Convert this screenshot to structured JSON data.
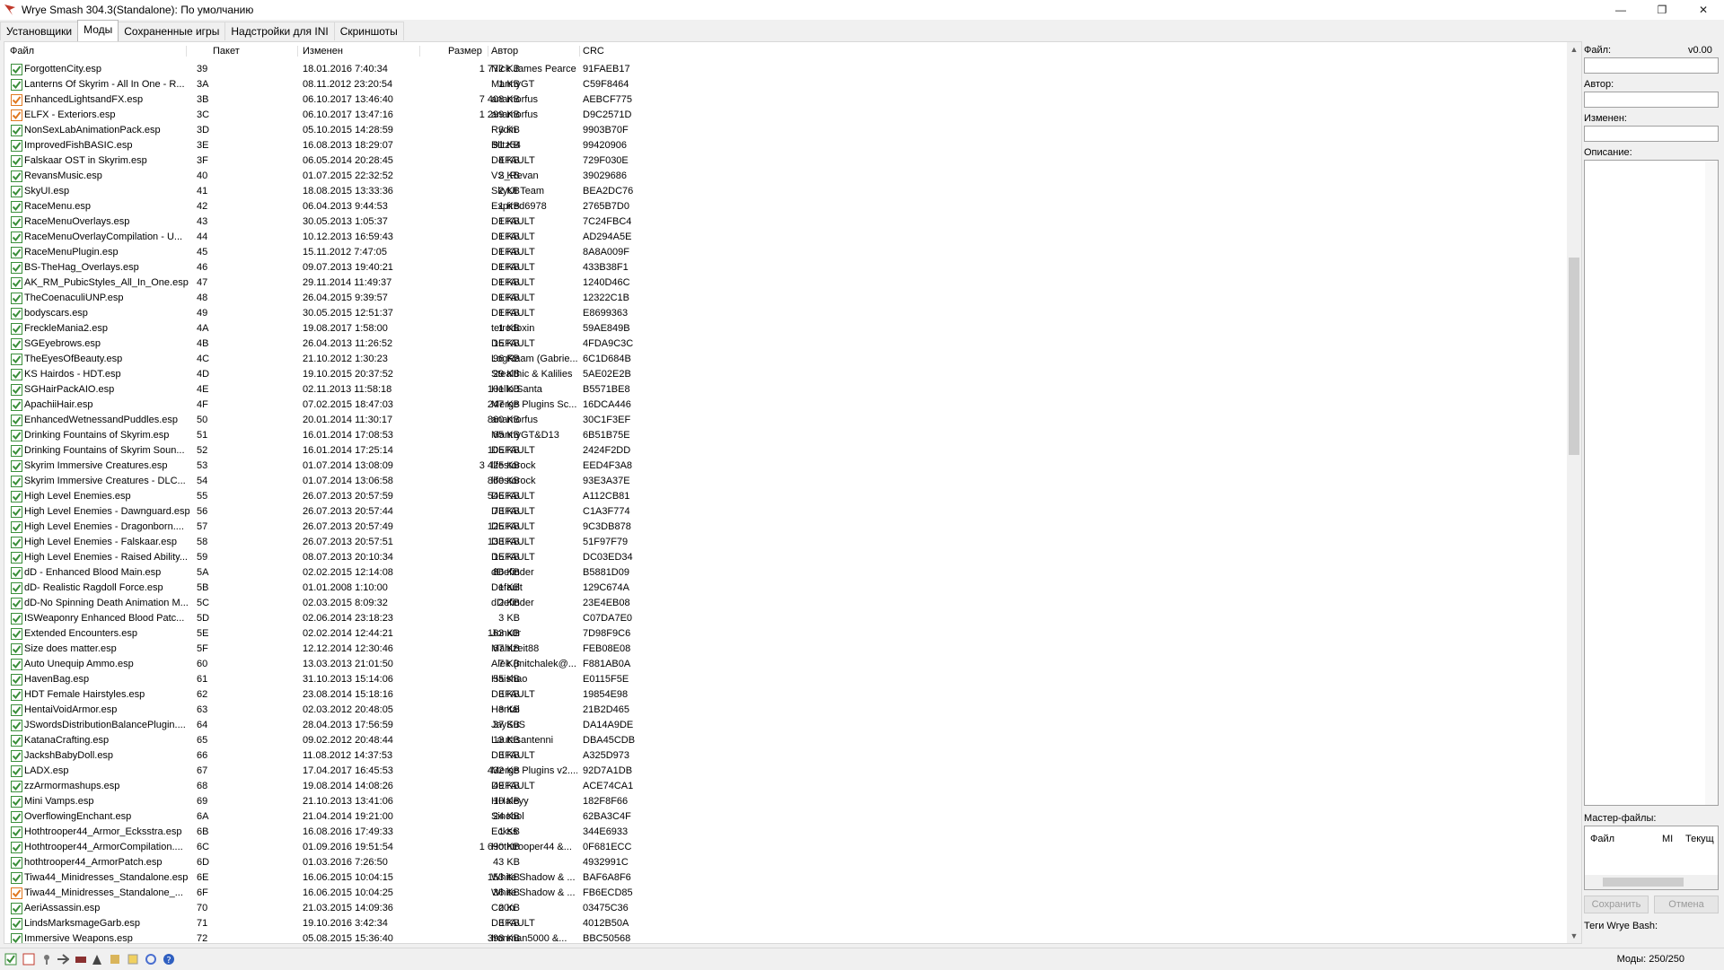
{
  "window": {
    "title": "Wrye Smash 304.3(Standalone): По умолчанию",
    "controls": [
      "—",
      "❐",
      "✕"
    ]
  },
  "tabs": [
    {
      "label": "Установщики",
      "active": false
    },
    {
      "label": "Моды",
      "active": true
    },
    {
      "label": "Сохраненные игры",
      "active": false
    },
    {
      "label": "Надстройки для INI",
      "active": false
    },
    {
      "label": "Скриншоты",
      "active": false
    }
  ],
  "columns": {
    "file": "Файл",
    "package": "Пакет",
    "modified": "Изменен",
    "size": "Размер",
    "author": "Автор",
    "crc": "CRC"
  },
  "rows": [
    {
      "file": "ForgottenCity.esp",
      "pkg": "39",
      "mod": "18.01.2016 7:40:34",
      "size": "1 772 KB",
      "author": "Nick James Pearce",
      "crc": "91FAEB17",
      "check": "green"
    },
    {
      "file": "Lanterns Of Skyrim - All In One - R...",
      "pkg": "3A",
      "mod": "08.11.2012 23:20:54",
      "size": "1 KB",
      "author": "MannyGT",
      "crc": "C59F8464",
      "check": "green"
    },
    {
      "file": "EnhancedLightsandFX.esp",
      "pkg": "3B",
      "mod": "06.10.2017 13:46:40",
      "size": "7 408 KB",
      "author": "anamorfus",
      "crc": "AEBCF775",
      "check": "orange"
    },
    {
      "file": "ELFX - Exteriors.esp",
      "pkg": "3C",
      "mod": "06.10.2017 13:47:16",
      "size": "1 299 KB",
      "author": "anamorfus",
      "crc": "D9C2571D",
      "check": "orange"
    },
    {
      "file": "NonSexLabAnimationPack.esp",
      "pkg": "3D",
      "mod": "05.10.2015 14:28:59",
      "size": "3 KB",
      "author": "Rydin",
      "crc": "9903B70F",
      "check": "green"
    },
    {
      "file": "ImprovedFishBASIC.esp",
      "pkg": "3E",
      "mod": "16.08.2013 18:29:07",
      "size": "91 KB",
      "author": "Blitz54",
      "crc": "99420906",
      "check": "green"
    },
    {
      "file": "Falskaar OST in Skyrim.esp",
      "pkg": "3F",
      "mod": "06.05.2014 20:28:45",
      "size": "4 KB",
      "author": "DEFAULT",
      "crc": "729F030E",
      "check": "green"
    },
    {
      "file": "RevansMusic.esp",
      "pkg": "40",
      "mod": "01.07.2015 22:32:52",
      "size": "2 KB",
      "author": "VS_Revan",
      "crc": "39029686",
      "check": "green"
    },
    {
      "file": "SkyUI.esp",
      "pkg": "41",
      "mod": "18.08.2015 13:33:36",
      "size": "2 KB",
      "author": "SkyUI Team",
      "crc": "BEA2DC76",
      "check": "green"
    },
    {
      "file": "RaceMenu.esp",
      "pkg": "42",
      "mod": "06.04.2013 9:44:53",
      "size": "1 KB",
      "author": "Expired6978",
      "crc": "2765B7D0",
      "check": "green"
    },
    {
      "file": "RaceMenuOverlays.esp",
      "pkg": "43",
      "mod": "30.05.2013 1:05:37",
      "size": "1 KB",
      "author": "DEFAULT",
      "crc": "7C24FBC4",
      "check": "green"
    },
    {
      "file": "RaceMenuOverlayCompilation - U...",
      "pkg": "44",
      "mod": "10.12.2013 16:59:43",
      "size": "1 KB",
      "author": "DEFAULT",
      "crc": "AD294A5E",
      "check": "green"
    },
    {
      "file": "RaceMenuPlugin.esp",
      "pkg": "45",
      "mod": "15.11.2012 7:47:05",
      "size": "1 KB",
      "author": "DEFAULT",
      "crc": "8A8A009F",
      "check": "green"
    },
    {
      "file": "BS-TheHag_Overlays.esp",
      "pkg": "46",
      "mod": "09.07.2013 19:40:21",
      "size": "1 KB",
      "author": "DEFAULT",
      "crc": "433B38F1",
      "check": "green"
    },
    {
      "file": "AK_RM_PubicStyles_All_In_One.esp",
      "pkg": "47",
      "mod": "29.11.2014 11:49:37",
      "size": "1 KB",
      "author": "DEFAULT",
      "crc": "1240D46C",
      "check": "green"
    },
    {
      "file": "TheCoenaculiUNP.esp",
      "pkg": "48",
      "mod": "26.04.2015 9:39:57",
      "size": "1 KB",
      "author": "DEFAULT",
      "crc": "12322C1B",
      "check": "green"
    },
    {
      "file": "bodyscars.esp",
      "pkg": "49",
      "mod": "30.05.2015 12:51:37",
      "size": "1 KB",
      "author": "DEFAULT",
      "crc": "E8699363",
      "check": "green"
    },
    {
      "file": "FreckleMania2.esp",
      "pkg": "4A",
      "mod": "19.08.2017 1:58:00",
      "size": "1 KB",
      "author": "tetrodoxin",
      "crc": "59AE849B",
      "check": "green"
    },
    {
      "file": "SGEyebrows.esp",
      "pkg": "4B",
      "mod": "26.04.2013 11:26:52",
      "size": "15 KB",
      "author": "DEFAULT",
      "crc": "4FDA9C3C",
      "check": "green"
    },
    {
      "file": "TheEyesOfBeauty.esp",
      "pkg": "4C",
      "mod": "21.10.2012 1:30:23",
      "size": "96 KB",
      "author": "LogRaam (Gabrie...",
      "crc": "6C1D684B",
      "check": "green"
    },
    {
      "file": "KS Hairdos - HDT.esp",
      "pkg": "4D",
      "mod": "19.10.2015 20:37:52",
      "size": "29 KB",
      "author": "Stealthic & Kalilies",
      "crc": "5AE02E2B",
      "check": "green"
    },
    {
      "file": "SGHairPackAIO.esp",
      "pkg": "4E",
      "mod": "02.11.2013 11:58:18",
      "size": "101 KB",
      "author": "Hello Santa",
      "crc": "B5571BE8",
      "check": "green"
    },
    {
      "file": "ApachiiHair.esp",
      "pkg": "4F",
      "mod": "07.02.2015 18:47:03",
      "size": "247 KB",
      "author": "Merge Plugins Sc...",
      "crc": "16DCA446",
      "check": "green"
    },
    {
      "file": "EnhancedWetnessandPuddles.esp",
      "pkg": "50",
      "mod": "20.01.2014 11:30:17",
      "size": "860 KB",
      "author": "anamorfus",
      "crc": "30C1F3EF",
      "check": "green"
    },
    {
      "file": "Drinking Fountains of Skyrim.esp",
      "pkg": "51",
      "mod": "16.01.2014 17:08:53",
      "size": "65 KB",
      "author": "MannyGT&D13",
      "crc": "6B51B75E",
      "check": "green"
    },
    {
      "file": "Drinking Fountains of Skyrim Soun...",
      "pkg": "52",
      "mod": "16.01.2014 17:25:14",
      "size": "105 KB",
      "author": "DEFAULT",
      "crc": "2424F2DD",
      "check": "green"
    },
    {
      "file": "Skyrim Immersive Creatures.esp",
      "pkg": "53",
      "mod": "01.07.2014 13:08:09",
      "size": "3 425 KB",
      "author": "lifestorock",
      "crc": "EED4F3A8",
      "check": "green"
    },
    {
      "file": "Skyrim Immersive Creatures - DLC...",
      "pkg": "54",
      "mod": "01.07.2014 13:06:58",
      "size": "860 KB",
      "author": "lifestorock",
      "crc": "93E3A37E",
      "check": "green"
    },
    {
      "file": "High Level Enemies.esp",
      "pkg": "55",
      "mod": "26.07.2013 20:57:59",
      "size": "546 KB",
      "author": "DEFAULT",
      "crc": "A112CB81",
      "check": "green"
    },
    {
      "file": "High Level Enemies - Dawnguard.esp",
      "pkg": "56",
      "mod": "26.07.2013 20:57:44",
      "size": "73 KB",
      "author": "DEFAULT",
      "crc": "C1A3F774",
      "check": "green"
    },
    {
      "file": "High Level Enemies - Dragonborn....",
      "pkg": "57",
      "mod": "26.07.2013 20:57:49",
      "size": "125 KB",
      "author": "DEFAULT",
      "crc": "9C3DB878",
      "check": "green"
    },
    {
      "file": "High Level Enemies - Falskaar.esp",
      "pkg": "58",
      "mod": "26.07.2013 20:57:51",
      "size": "133 KB",
      "author": "DEFAULT",
      "crc": "51F97F79",
      "check": "green"
    },
    {
      "file": "High Level Enemies - Raised Ability...",
      "pkg": "59",
      "mod": "08.07.2013 20:10:34",
      "size": "15 KB",
      "author": "DEFAULT",
      "crc": "DC03ED34",
      "check": "green"
    },
    {
      "file": "dD - Enhanced Blood Main.esp",
      "pkg": "5A",
      "mod": "02.02.2015 12:14:08",
      "size": "86 KB",
      "author": "dDefinder",
      "crc": "B5881D09",
      "check": "green"
    },
    {
      "file": "dD- Realistic Ragdoll Force.esp",
      "pkg": "5B",
      "mod": "01.01.2008 1:10:00",
      "size": "1 KB",
      "author": "Default",
      "crc": "129C674A",
      "check": "green"
    },
    {
      "file": "dD-No Spinning Death Animation M...",
      "pkg": "5C",
      "mod": "02.03.2015 8:09:32",
      "size": "2 KB",
      "author": "dDefinder",
      "crc": "23E4EB08",
      "check": "green"
    },
    {
      "file": "ISWeaponry Enhanced Blood Patc...",
      "pkg": "5D",
      "mod": "02.06.2014 23:18:23",
      "size": "3 KB",
      "author": "",
      "crc": "C07DA7E0",
      "check": "green"
    },
    {
      "file": "Extended Encounters.esp",
      "pkg": "5E",
      "mod": "02.02.2014 12:44:21",
      "size": "163 KB",
      "author": "Jonx0r",
      "crc": "7D98F9C6",
      "check": "green"
    },
    {
      "file": "Size does matter.esp",
      "pkg": "5F",
      "mod": "12.12.2014 12:30:46",
      "size": "67 KB",
      "author": "Mahlzeit88",
      "crc": "FEB08E08",
      "check": "green"
    },
    {
      "file": "Auto Unequip Ammo.esp",
      "pkg": "60",
      "mod": "13.03.2013 21:01:50",
      "size": "7 KB",
      "author": "Alek (mitchalek@...",
      "crc": "F881AB0A",
      "check": "green"
    },
    {
      "file": "HavenBag.esp",
      "pkg": "61",
      "mod": "31.10.2013 15:14:06",
      "size": "55 KB",
      "author": "Haishao",
      "crc": "E0115F5E",
      "check": "green"
    },
    {
      "file": "HDT Female Hairstyles.esp",
      "pkg": "62",
      "mod": "23.08.2014 15:18:16",
      "size": "3 KB",
      "author": "DEFAULT",
      "crc": "19854E98",
      "check": "green"
    },
    {
      "file": "HentaiVoidArmor.esp",
      "pkg": "63",
      "mod": "02.03.2012 20:48:05",
      "size": "3 KB",
      "author": "Hentai",
      "crc": "21B2D465",
      "check": "green"
    },
    {
      "file": "JSwordsDistributionBalancePlugin....",
      "pkg": "64",
      "mod": "28.04.2013 17:56:59",
      "size": "37 KB",
      "author": "JaySuS",
      "crc": "DA14A9DE",
      "check": "green"
    },
    {
      "file": "KatanaCrafting.esp",
      "pkg": "65",
      "mod": "09.02.2012 20:48:44",
      "size": "13 KB",
      "author": "Lautasantenni",
      "crc": "DBA45CDB",
      "check": "green"
    },
    {
      "file": "JackshBabyDoll.esp",
      "pkg": "66",
      "mod": "11.08.2012 14:37:53",
      "size": "3 KB",
      "author": "DEFAULT",
      "crc": "A325D973",
      "check": "green"
    },
    {
      "file": "LADX.esp",
      "pkg": "67",
      "mod": "17.04.2017 16:45:53",
      "size": "432 KB",
      "author": "Merge Plugins v2....",
      "crc": "92D7A1DB",
      "check": "green"
    },
    {
      "file": "zzArmormashups.esp",
      "pkg": "68",
      "mod": "19.08.2014 14:08:26",
      "size": "49 KB",
      "author": "DEFAULT",
      "crc": "ACE74CA1",
      "check": "green"
    },
    {
      "file": "Mini Vamps.esp",
      "pkg": "69",
      "mod": "21.10.2013 13:41:06",
      "size": "10 KB",
      "author": "HHaleyy",
      "crc": "182F8F66",
      "check": "green"
    },
    {
      "file": "OverflowingEnchant.esp",
      "pkg": "6A",
      "mod": "21.04.2014 19:21:00",
      "size": "24 KB",
      "author": "Sinobol",
      "crc": "62BA3C4F",
      "check": "green"
    },
    {
      "file": "Hothtrooper44_Armor_Ecksstra.esp",
      "pkg": "6B",
      "mod": "16.08.2016 17:49:33",
      "size": "1 KB",
      "author": "Eckss",
      "crc": "344E6933",
      "check": "green"
    },
    {
      "file": "Hothtrooper44_ArmorCompilation....",
      "pkg": "6C",
      "mod": "01.09.2016 19:51:54",
      "size": "1 690 KB",
      "author": "Hothtrooper44 &...",
      "crc": "0F681ECC",
      "check": "green"
    },
    {
      "file": "hothtrooper44_ArmorPatch.esp",
      "pkg": "6D",
      "mod": "01.03.2016 7:26:50",
      "size": "43 KB",
      "author": "",
      "crc": "4932991C",
      "check": "green"
    },
    {
      "file": "Tiwa44_Minidresses_Standalone.esp",
      "pkg": "6E",
      "mod": "16.06.2015 10:04:15",
      "size": "153 KB",
      "author": "White Shadow & ...",
      "crc": "BAF6A8F6",
      "check": "green"
    },
    {
      "file": "Tiwa44_Minidresses_Standalone_...",
      "pkg": "6F",
      "mod": "16.06.2015 10:04:25",
      "size": "36 KB",
      "author": "White Shadow & ...",
      "crc": "FB6ECD85",
      "check": "orange"
    },
    {
      "file": "AeriAssassin.esp",
      "pkg": "70",
      "mod": "21.03.2015 14:09:36",
      "size": "2 KB",
      "author": "Co0n",
      "crc": "03475C36",
      "check": "green"
    },
    {
      "file": "LindsMarksmageGarb.esp",
      "pkg": "71",
      "mod": "19.10.2016 3:42:34",
      "size": "3 KB",
      "author": "DEFAULT",
      "crc": "4012B50A",
      "check": "green"
    },
    {
      "file": "Immersive Weapons.esp",
      "pkg": "72",
      "mod": "05.08.2015 15:36:40",
      "size": "398 KB",
      "author": "Ironman5000 &...",
      "crc": "BBC50568",
      "check": "green"
    }
  ],
  "details": {
    "file_label": "Файл:",
    "version": "v0.00",
    "author_label": "Автор:",
    "modified_label": "Изменен:",
    "description_label": "Описание:",
    "masters_label": "Мастер-файлы:",
    "masters_columns": [
      "Файл",
      "MI",
      "Текущ"
    ],
    "save_button": "Сохранить",
    "cancel_button": "Отмена",
    "tags_label": "Теги Wrye Bash:"
  },
  "status": {
    "mods_count": "Моды: 250/250"
  },
  "colors": {
    "check_green": "#3a8e3a",
    "check_orange": "#e07820",
    "app_icon_red": "#c0392b"
  }
}
